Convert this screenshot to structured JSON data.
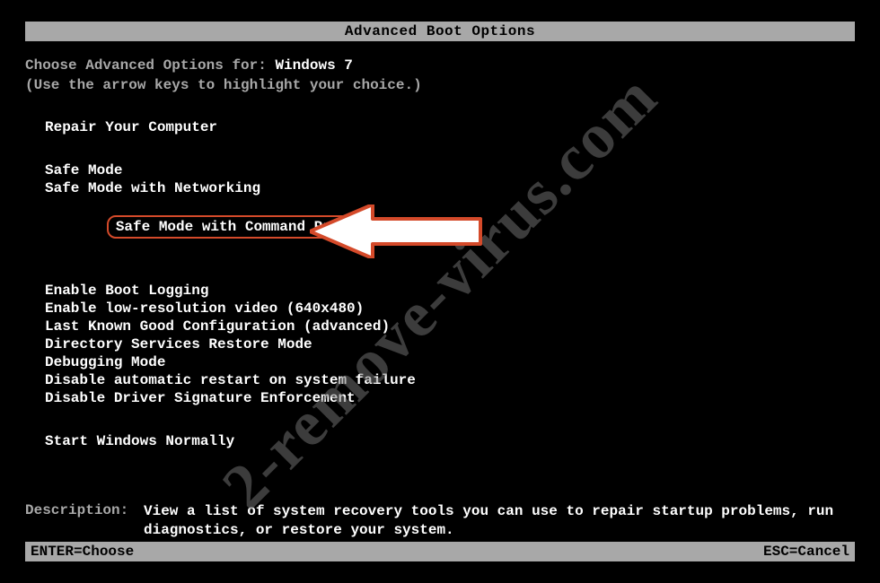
{
  "title": "Advanced Boot Options",
  "intro": {
    "prefix": "Choose Advanced Options for: ",
    "os_name": "Windows 7",
    "hint": "(Use the arrow keys to highlight your choice.)"
  },
  "groups": {
    "repair": [
      "Repair Your Computer"
    ],
    "safe": [
      "Safe Mode",
      "Safe Mode with Networking",
      "Safe Mode with Command Prompt"
    ],
    "advanced": [
      "Enable Boot Logging",
      "Enable low-resolution video (640x480)",
      "Last Known Good Configuration (advanced)",
      "Directory Services Restore Mode",
      "Debugging Mode",
      "Disable automatic restart on system failure",
      "Disable Driver Signature Enforcement"
    ],
    "normal": [
      "Start Windows Normally"
    ]
  },
  "highlighted_option": "Safe Mode with Command Prompt",
  "description": {
    "label": "Description:",
    "text": "View a list of system recovery tools you can use to repair startup problems, run diagnostics, or restore your system."
  },
  "footer": {
    "enter": "ENTER=Choose",
    "esc": "ESC=Cancel"
  },
  "watermark": "2-remove-virus.com",
  "arrow_icon": "arrow-left"
}
